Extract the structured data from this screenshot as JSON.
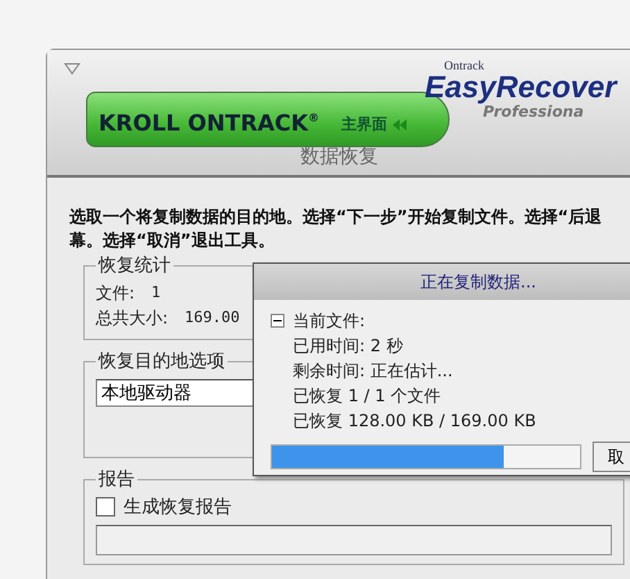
{
  "header": {
    "brand": "KROLL ONTRACK$^{®}$",
    "home_link": "主界面",
    "logo": {
      "maker": "Ontrack",
      "product": "EasyRecover",
      "edition": "Professiona"
    }
  },
  "page_title": "数据恢复",
  "instructions": [
    "选取一个将复制数据的目的地。选择“下一步”开始复制文件。选择“后退",
    "幕。选择“取消”退出工具。"
  ],
  "stats": {
    "title": "恢复统计",
    "rows": [
      {
        "label": "文件:",
        "value": "1"
      },
      {
        "label": "总共大小:",
        "value": "169.00"
      }
    ]
  },
  "destination": {
    "title": "恢复目的地选项",
    "value": "本地驱动器"
  },
  "report": {
    "title": "报告",
    "checkbox": {
      "label": "生成恢复报告",
      "checked": false
    }
  },
  "dialog": {
    "title": "正在复制数据...",
    "expanded": true,
    "lines": [
      "当前文件:",
      "已用时间: 2 秒",
      "剩余时间: 正在估计...",
      "已恢复 1 / 1 个文件",
      "已恢复 128.00 KB / 169.00 KB"
    ],
    "progress": {
      "level": 0.75
    },
    "button": "取"
  }
}
